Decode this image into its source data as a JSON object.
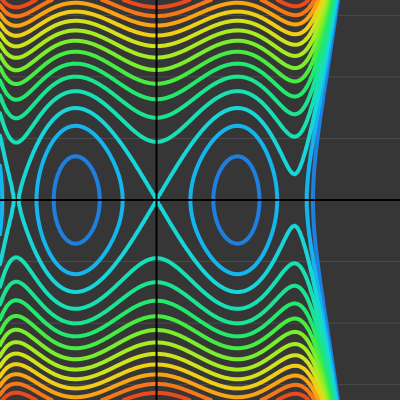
{
  "plot": {
    "background": "#363636",
    "grid_color": "#4a4a4a",
    "axis_color": "#000000",
    "x_range": [
      -3.6,
      5.6
    ],
    "y_range": [
      -5.2,
      5.2
    ],
    "grid_step_x": 3.5,
    "grid_step_y": 1.6
  },
  "contours": {
    "description_level_order": "inner to outer",
    "levels": [
      {
        "value": -1.55,
        "color": "#1e7fe0"
      },
      {
        "value": -0.7,
        "color": "#14b4ec"
      },
      {
        "value": 0.0,
        "color": "#18d6d8"
      },
      {
        "value": 0.8,
        "color": "#16e0b4"
      },
      {
        "value": 1.6,
        "color": "#1ae490"
      },
      {
        "value": 2.4,
        "color": "#22e86c"
      },
      {
        "value": 3.2,
        "color": "#46ec42"
      },
      {
        "value": 4.0,
        "color": "#78ee2c"
      },
      {
        "value": 4.8,
        "color": "#a6ec22"
      },
      {
        "value": 5.6,
        "color": "#cfe41c"
      },
      {
        "value": 6.4,
        "color": "#f0d016"
      },
      {
        "value": 7.2,
        "color": "#faa414"
      },
      {
        "value": 8.0,
        "color": "#f67618"
      },
      {
        "value": 8.8,
        "color": "#ea4a1c"
      }
    ]
  }
}
